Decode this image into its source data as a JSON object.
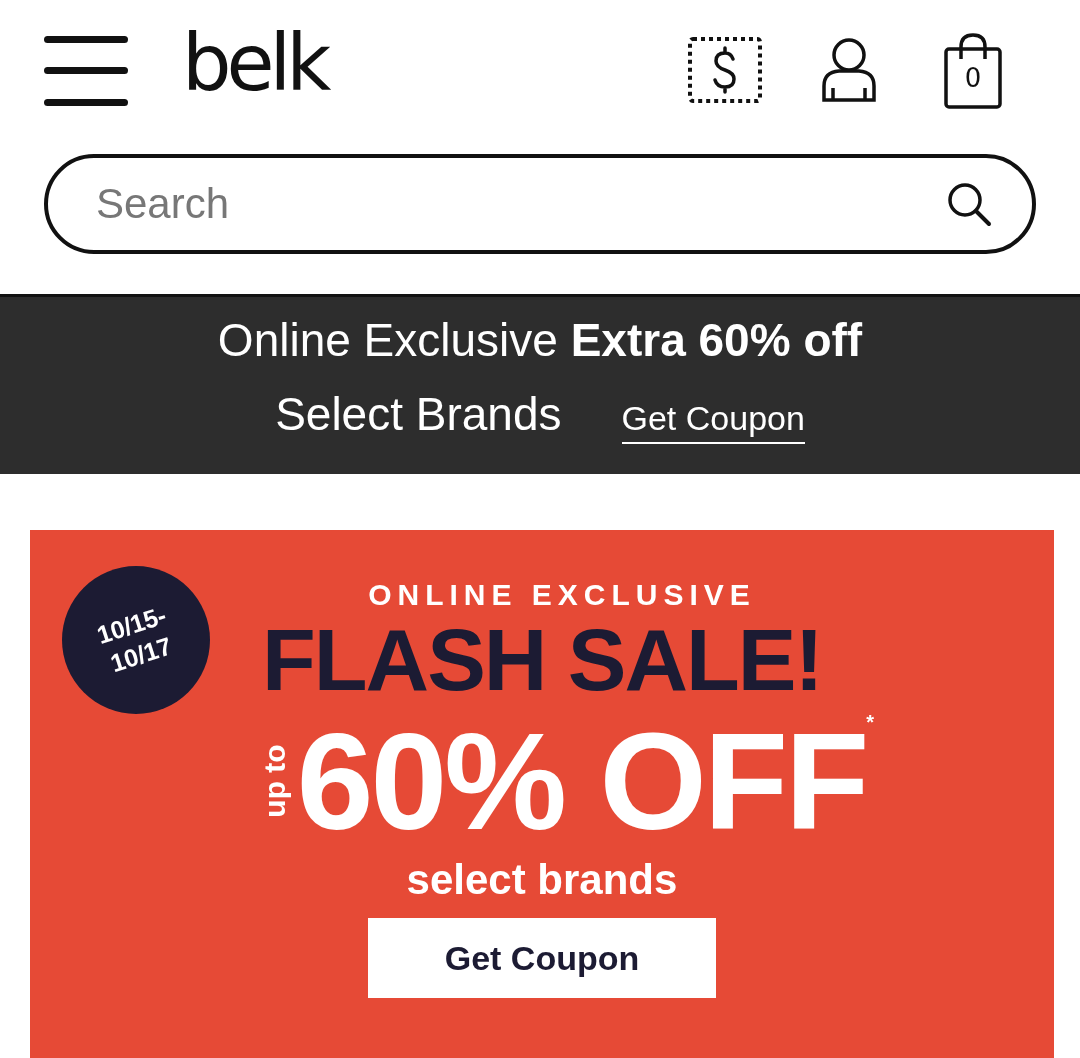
{
  "header": {
    "logo": "belk",
    "cart_count": "0"
  },
  "search": {
    "placeholder": "Search"
  },
  "promo_bar": {
    "text": "Online Exclusive **Extra 60% off**",
    "subtext": "Select Brands",
    "link": "Get Coupon"
  },
  "hero": {
    "date_lines": [
      "10/15-",
      "10/17"
    ],
    "eyebrow": "ONLINE EXCLUSIVE",
    "headline": "FLASH SALE!",
    "prefix": "up to",
    "offer": "60% OFF$^{*}$",
    "subline": "select brands",
    "button": "Get Coupon"
  }
}
